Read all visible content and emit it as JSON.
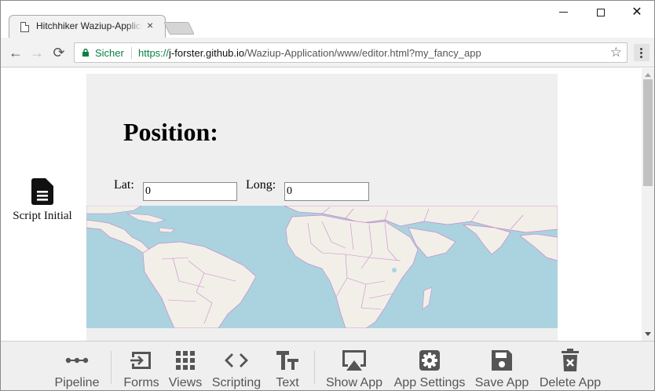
{
  "browser": {
    "tab_title": "Hitchhiker Waziup-Application Editor",
    "tab_close": "×",
    "secure_label": "Sicher",
    "url_scheme": "https://",
    "url_host": "j-forster.github.io",
    "url_path": "/Waziup-Application/www/editor.html?my_fancy_app",
    "back_icon": "←",
    "forward_icon": "→",
    "reload_icon": "⟳",
    "star_icon": "☆",
    "close_icon": "✕"
  },
  "sidebar": {
    "script_label": "Script Initial",
    "script_icon": "file-text-icon"
  },
  "preview": {
    "title": "Position:",
    "lat_label": "Lat:",
    "lat_value": "0",
    "long_label": "Long:",
    "long_value": "0"
  },
  "dock": {
    "items": [
      {
        "label": "Pipeline",
        "icon": "pipeline-icon"
      },
      {
        "label": "Forms",
        "icon": "forms-icon"
      },
      {
        "label": "Views",
        "icon": "views-grid-icon"
      },
      {
        "label": "Scripting",
        "icon": "code-icon"
      },
      {
        "label": "Text",
        "icon": "text-icon"
      },
      {
        "label": "Show App",
        "icon": "show-app-icon"
      },
      {
        "label": "App Settings",
        "icon": "settings-icon"
      },
      {
        "label": "Save App",
        "icon": "save-icon"
      },
      {
        "label": "Delete App",
        "icon": "delete-icon"
      }
    ]
  },
  "colors": {
    "secure_green": "#0b8043",
    "map_water": "#aad3df",
    "map_land": "#f2efe9",
    "map_border": "#c98ac9",
    "dock_icon": "#555555"
  }
}
